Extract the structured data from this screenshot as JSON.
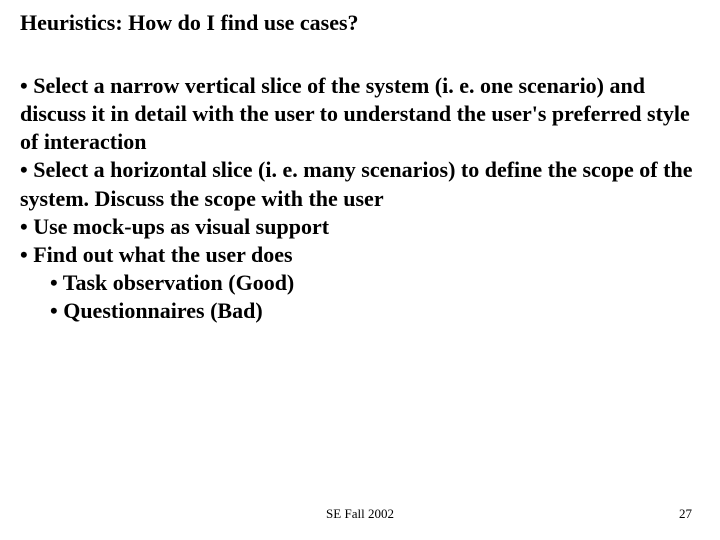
{
  "title": "Heuristics: How do I find use cases?",
  "bullets": {
    "b1": "• Select a narrow vertical slice of the system (i. e. one scenario) and discuss it in detail with the user to understand the user's preferred style of interaction",
    "b2": "• Select a horizontal slice (i. e. many scenarios) to define the scope of the system. Discuss the scope with the user",
    "b3": "• Use mock-ups as visual support",
    "b4": "• Find out what the user does",
    "b4a": "• Task observation (Good)",
    "b4b": "• Questionnaires (Bad)"
  },
  "footer": {
    "center": "SE Fall 2002",
    "page": "27"
  }
}
